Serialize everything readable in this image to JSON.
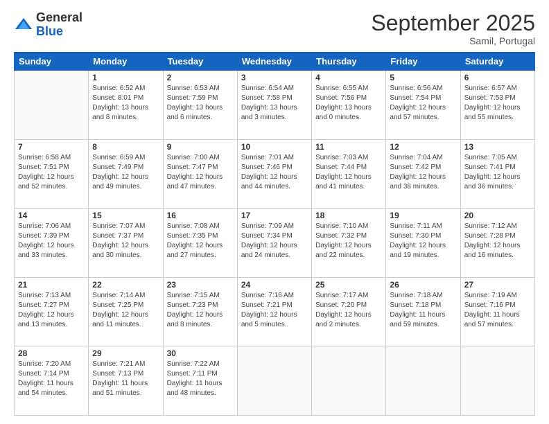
{
  "logo": {
    "general": "General",
    "blue": "Blue"
  },
  "title": "September 2025",
  "location": "Samil, Portugal",
  "days_of_week": [
    "Sunday",
    "Monday",
    "Tuesday",
    "Wednesday",
    "Thursday",
    "Friday",
    "Saturday"
  ],
  "weeks": [
    [
      {
        "num": "",
        "info": ""
      },
      {
        "num": "1",
        "info": "Sunrise: 6:52 AM\nSunset: 8:01 PM\nDaylight: 13 hours\nand 8 minutes."
      },
      {
        "num": "2",
        "info": "Sunrise: 6:53 AM\nSunset: 7:59 PM\nDaylight: 13 hours\nand 6 minutes."
      },
      {
        "num": "3",
        "info": "Sunrise: 6:54 AM\nSunset: 7:58 PM\nDaylight: 13 hours\nand 3 minutes."
      },
      {
        "num": "4",
        "info": "Sunrise: 6:55 AM\nSunset: 7:56 PM\nDaylight: 13 hours\nand 0 minutes."
      },
      {
        "num": "5",
        "info": "Sunrise: 6:56 AM\nSunset: 7:54 PM\nDaylight: 12 hours\nand 57 minutes."
      },
      {
        "num": "6",
        "info": "Sunrise: 6:57 AM\nSunset: 7:53 PM\nDaylight: 12 hours\nand 55 minutes."
      }
    ],
    [
      {
        "num": "7",
        "info": "Sunrise: 6:58 AM\nSunset: 7:51 PM\nDaylight: 12 hours\nand 52 minutes."
      },
      {
        "num": "8",
        "info": "Sunrise: 6:59 AM\nSunset: 7:49 PM\nDaylight: 12 hours\nand 49 minutes."
      },
      {
        "num": "9",
        "info": "Sunrise: 7:00 AM\nSunset: 7:47 PM\nDaylight: 12 hours\nand 47 minutes."
      },
      {
        "num": "10",
        "info": "Sunrise: 7:01 AM\nSunset: 7:46 PM\nDaylight: 12 hours\nand 44 minutes."
      },
      {
        "num": "11",
        "info": "Sunrise: 7:03 AM\nSunset: 7:44 PM\nDaylight: 12 hours\nand 41 minutes."
      },
      {
        "num": "12",
        "info": "Sunrise: 7:04 AM\nSunset: 7:42 PM\nDaylight: 12 hours\nand 38 minutes."
      },
      {
        "num": "13",
        "info": "Sunrise: 7:05 AM\nSunset: 7:41 PM\nDaylight: 12 hours\nand 36 minutes."
      }
    ],
    [
      {
        "num": "14",
        "info": "Sunrise: 7:06 AM\nSunset: 7:39 PM\nDaylight: 12 hours\nand 33 minutes."
      },
      {
        "num": "15",
        "info": "Sunrise: 7:07 AM\nSunset: 7:37 PM\nDaylight: 12 hours\nand 30 minutes."
      },
      {
        "num": "16",
        "info": "Sunrise: 7:08 AM\nSunset: 7:35 PM\nDaylight: 12 hours\nand 27 minutes."
      },
      {
        "num": "17",
        "info": "Sunrise: 7:09 AM\nSunset: 7:34 PM\nDaylight: 12 hours\nand 24 minutes."
      },
      {
        "num": "18",
        "info": "Sunrise: 7:10 AM\nSunset: 7:32 PM\nDaylight: 12 hours\nand 22 minutes."
      },
      {
        "num": "19",
        "info": "Sunrise: 7:11 AM\nSunset: 7:30 PM\nDaylight: 12 hours\nand 19 minutes."
      },
      {
        "num": "20",
        "info": "Sunrise: 7:12 AM\nSunset: 7:28 PM\nDaylight: 12 hours\nand 16 minutes."
      }
    ],
    [
      {
        "num": "21",
        "info": "Sunrise: 7:13 AM\nSunset: 7:27 PM\nDaylight: 12 hours\nand 13 minutes."
      },
      {
        "num": "22",
        "info": "Sunrise: 7:14 AM\nSunset: 7:25 PM\nDaylight: 12 hours\nand 11 minutes."
      },
      {
        "num": "23",
        "info": "Sunrise: 7:15 AM\nSunset: 7:23 PM\nDaylight: 12 hours\nand 8 minutes."
      },
      {
        "num": "24",
        "info": "Sunrise: 7:16 AM\nSunset: 7:21 PM\nDaylight: 12 hours\nand 5 minutes."
      },
      {
        "num": "25",
        "info": "Sunrise: 7:17 AM\nSunset: 7:20 PM\nDaylight: 12 hours\nand 2 minutes."
      },
      {
        "num": "26",
        "info": "Sunrise: 7:18 AM\nSunset: 7:18 PM\nDaylight: 11 hours\nand 59 minutes."
      },
      {
        "num": "27",
        "info": "Sunrise: 7:19 AM\nSunset: 7:16 PM\nDaylight: 11 hours\nand 57 minutes."
      }
    ],
    [
      {
        "num": "28",
        "info": "Sunrise: 7:20 AM\nSunset: 7:14 PM\nDaylight: 11 hours\nand 54 minutes."
      },
      {
        "num": "29",
        "info": "Sunrise: 7:21 AM\nSunset: 7:13 PM\nDaylight: 11 hours\nand 51 minutes."
      },
      {
        "num": "30",
        "info": "Sunrise: 7:22 AM\nSunset: 7:11 PM\nDaylight: 11 hours\nand 48 minutes."
      },
      {
        "num": "",
        "info": ""
      },
      {
        "num": "",
        "info": ""
      },
      {
        "num": "",
        "info": ""
      },
      {
        "num": "",
        "info": ""
      }
    ]
  ]
}
